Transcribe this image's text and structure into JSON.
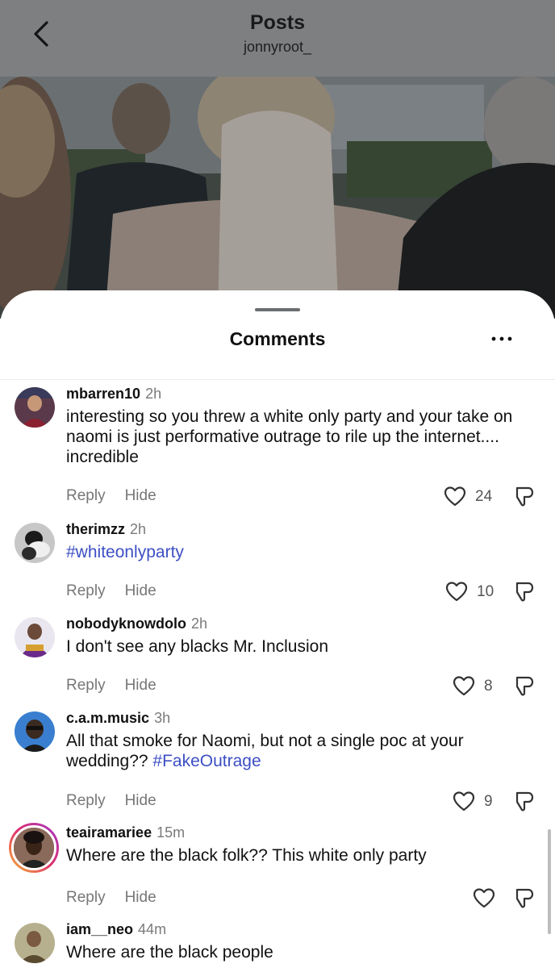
{
  "header": {
    "title": "Posts",
    "subtitle": "jonnyroot_"
  },
  "icons": {
    "back": "chevron-left-icon",
    "more": "more-horizontal-icon",
    "like": "heart-outline-icon",
    "dislike": "thumbs-down-icon"
  },
  "colors": {
    "header_overlay": "#7d7f81",
    "hashtag": "#3c4fc4",
    "story_ring": [
      "#f7b733",
      "#e1306c",
      "#a234c7"
    ]
  },
  "sheet": {
    "title": "Comments"
  },
  "actions": {
    "reply": "Reply",
    "hide": "Hide"
  },
  "comments": [
    {
      "username": "mbarren10",
      "time": "2h",
      "text": "interesting so you threw a white only party and your take on naomi is just performative outrage to rile up the internet.... incredible",
      "likes": "24"
    },
    {
      "username": "therimzz",
      "time": "2h",
      "hashtag": "#whiteonlyparty",
      "likes": "10"
    },
    {
      "username": "nobodyknowdolo",
      "time": "2h",
      "text": "I don't see any blacks Mr. Inclusion",
      "likes": "8"
    },
    {
      "username": "c.a.m.music",
      "time": "3h",
      "text": "All that smoke for Naomi, but not a single poc at your wedding?? ",
      "hashtag": "#FakeOutrage",
      "likes": "9"
    },
    {
      "username": "teairamariee",
      "time": "15m",
      "text": "Where are the black folk?? This white only party",
      "likes": ""
    },
    {
      "username": "iam__neo",
      "time": "44m",
      "text": "Where are the black people"
    }
  ]
}
